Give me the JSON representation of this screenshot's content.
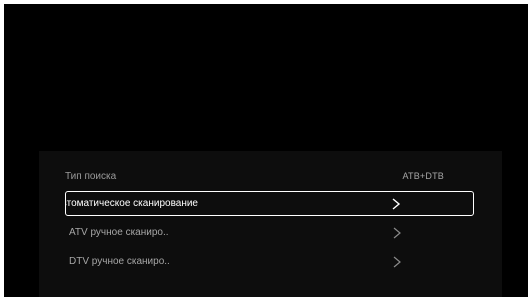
{
  "menu": {
    "header": {
      "label": "Тип поиска",
      "value": "ATB+DTB"
    },
    "items": [
      {
        "label": "Автоматическое сканирование",
        "focused": true
      },
      {
        "label": "ATV ручное сканиро..",
        "focused": false
      },
      {
        "label": "DTV ручное сканиро..",
        "focused": false
      }
    ]
  },
  "colors": {
    "background": "#000000",
    "panel": "#0d0d0d",
    "focus_border": "#ffffff",
    "text": "#a6a6a6"
  },
  "icons": {
    "item_arrow": "chevron-right-icon"
  }
}
